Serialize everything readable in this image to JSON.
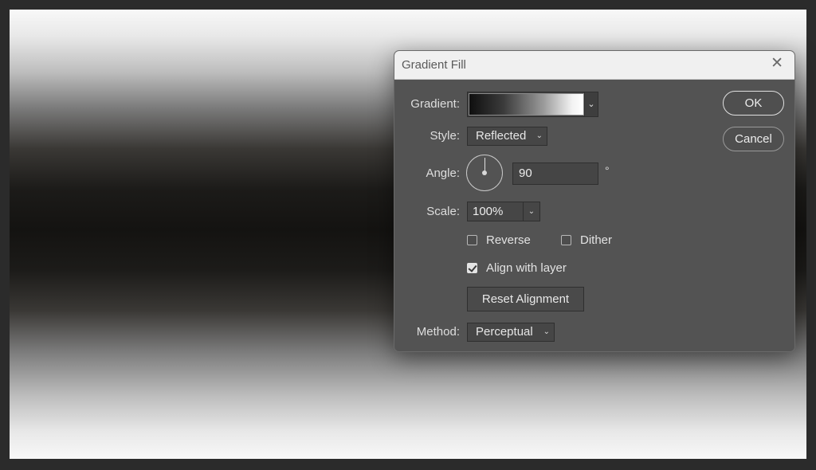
{
  "dialog": {
    "title": "Gradient Fill",
    "close_icon": "close-icon"
  },
  "gradient": {
    "label": "Gradient:",
    "swatch_colors": [
      "#0f0f0f",
      "#ffffff"
    ]
  },
  "style": {
    "label": "Style:",
    "value": "Reflected"
  },
  "angle": {
    "label": "Angle:",
    "value": "90",
    "unit": "°"
  },
  "scale": {
    "label": "Scale:",
    "value": "100%"
  },
  "options": {
    "reverse_label": "Reverse",
    "reverse_checked": false,
    "dither_label": "Dither",
    "dither_checked": false,
    "align_label": "Align with layer",
    "align_checked": true
  },
  "reset_alignment_label": "Reset Alignment",
  "method": {
    "label": "Method:",
    "value": "Perceptual"
  },
  "buttons": {
    "ok": "OK",
    "cancel": "Cancel"
  },
  "colors": {
    "dialog_bg": "#535353",
    "titlebar_bg": "#f0f0f0",
    "canvas_dark": "#141311",
    "canvas_light": "#f8f8f8"
  }
}
